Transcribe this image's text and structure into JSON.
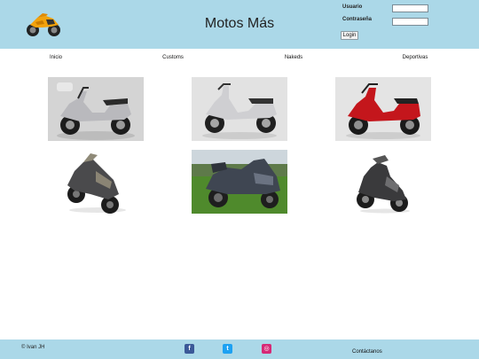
{
  "header": {
    "title": "Motos Más",
    "logo_icon": "motorcycle-logo-icon",
    "login": {
      "user_label": "Usuario",
      "password_label": "Contraseña",
      "user_value": "",
      "password_value": "",
      "button_label": "Login"
    }
  },
  "nav": {
    "items": [
      {
        "label": "Inicio"
      },
      {
        "label": "Customs"
      },
      {
        "label": "Nakeds"
      },
      {
        "label": "Deportivas"
      }
    ]
  },
  "gallery": {
    "photos": [
      {
        "subject": "silver scooter",
        "background": "light gray"
      },
      {
        "subject": "silver scooter",
        "background": "light gray"
      },
      {
        "subject": "red scooter",
        "background": "light gray"
      },
      {
        "subject": "dark maxi scooter",
        "background": "white"
      },
      {
        "subject": "dark gray maxi scooter",
        "background": "grass field"
      },
      {
        "subject": "dark scooter",
        "background": "white"
      }
    ]
  },
  "footer": {
    "copyright": "© Ivan JH",
    "contact_label": "Contáctanos",
    "social": [
      {
        "icon": "facebook-icon",
        "color": "#3b5998",
        "glyph": "f"
      },
      {
        "icon": "twitter-icon",
        "color": "#1da1f2",
        "glyph": "t"
      },
      {
        "icon": "instagram-icon",
        "color": "#d62976",
        "glyph": "◎"
      }
    ]
  },
  "colors": {
    "header_bg": "#abd8e8",
    "footer_bg": "#abd8e8"
  }
}
